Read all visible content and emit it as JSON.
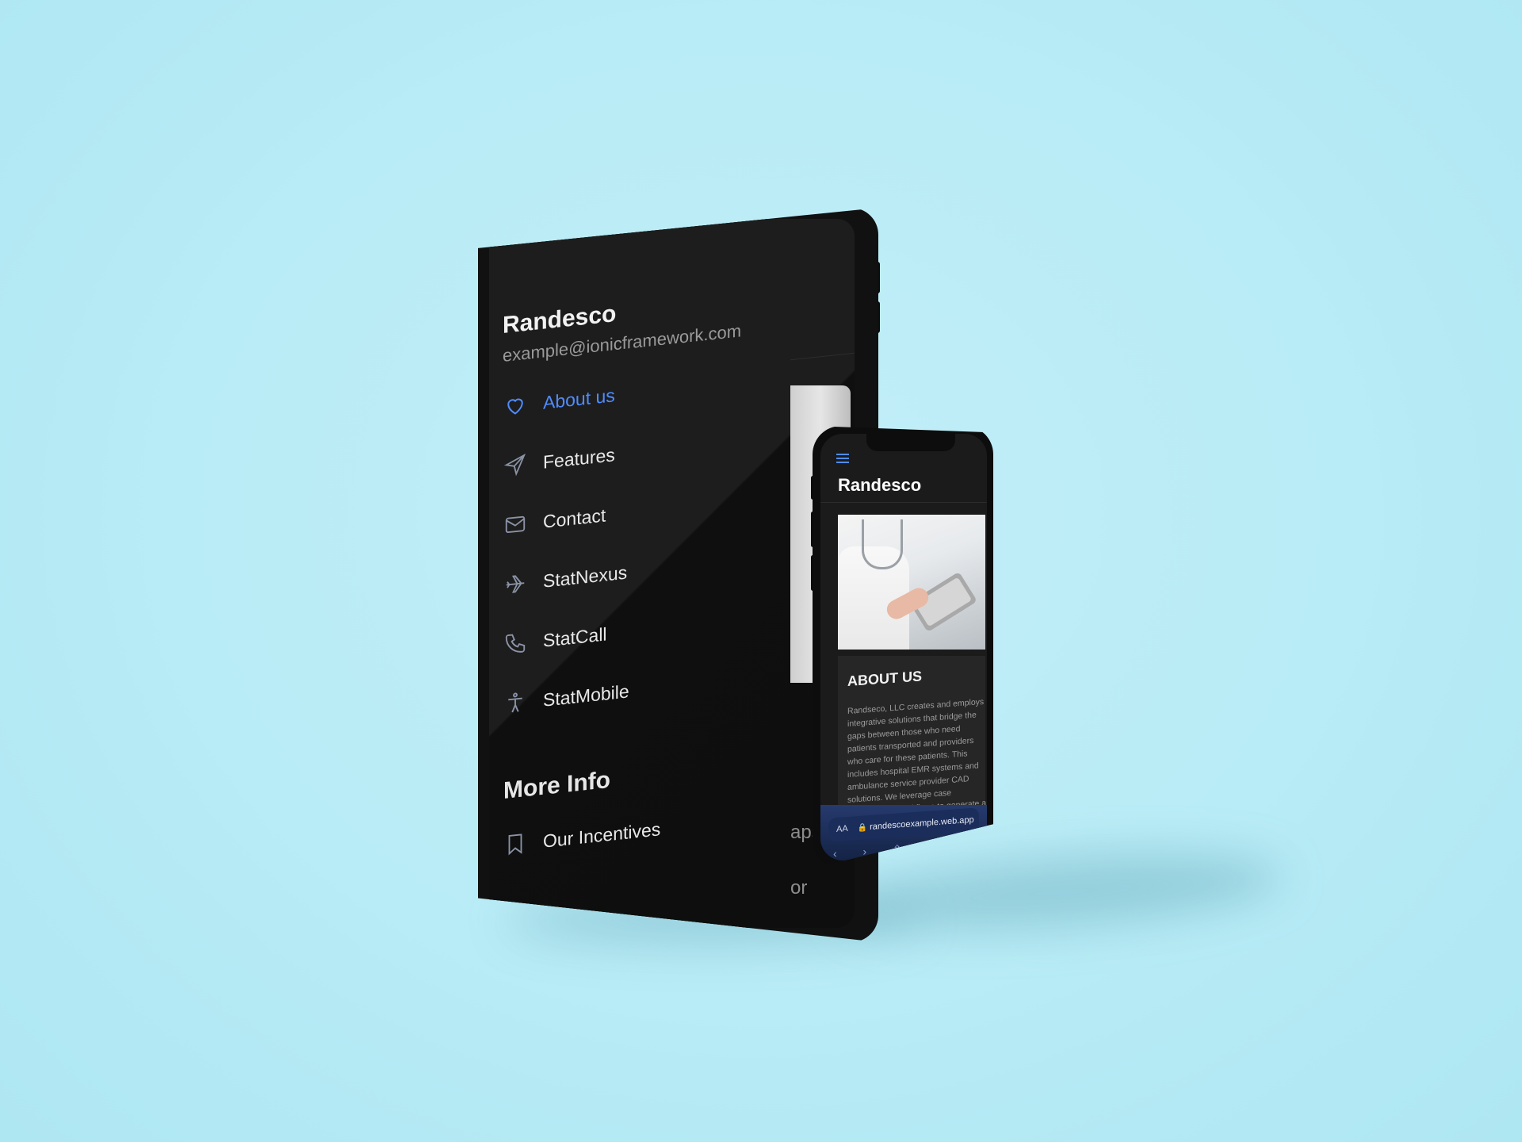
{
  "tablet": {
    "header": {
      "title": "Randesco",
      "email": "example@ionicframework.com"
    },
    "menu_items": [
      {
        "label": "About us",
        "icon": "heart-icon",
        "active": true
      },
      {
        "label": "Features",
        "icon": "paper-plane-icon",
        "active": false
      },
      {
        "label": "Contact",
        "icon": "mail-icon",
        "active": false
      },
      {
        "label": "StatNexus",
        "icon": "airplane-icon",
        "active": false
      },
      {
        "label": "StatCall",
        "icon": "phone-icon",
        "active": false
      },
      {
        "label": "StatMobile",
        "icon": "accessibility-icon",
        "active": false
      }
    ],
    "more_info": {
      "title": "More Info",
      "items": [
        {
          "label": "Our Incentives",
          "icon": "bookmark-icon"
        }
      ]
    },
    "content_fragments": [
      "aps",
      "or"
    ],
    "colors": {
      "accent": "#4f8cff",
      "background": "#151515"
    }
  },
  "phone": {
    "title": "Randesco",
    "menu_icon": "hamburger-icon",
    "about": {
      "heading": "ABOUT US",
      "body": "Randseco, LLC creates and employs integrative solutions that bridge the gaps between those who need patients transported and providers who care for these patients. This includes hospital EMR systems and ambulance service provider CAD solutions. We leverage case management workflows to generate a more functional, reliable and streamlined patient service experience."
    },
    "browser": {
      "text_size_label": "AA",
      "url": "randescoexample.web.app"
    }
  },
  "background_color": "#b8ecf6"
}
